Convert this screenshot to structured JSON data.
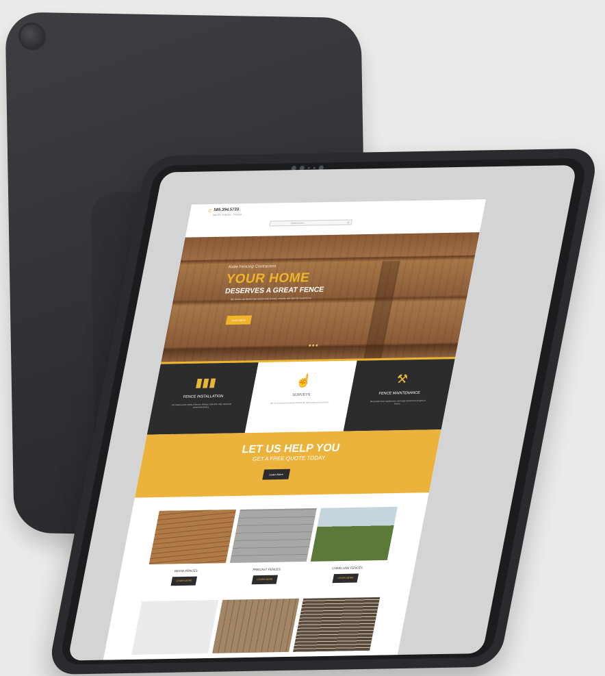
{
  "header": {
    "phone": "585.394.5733",
    "phone_sub": "Mon-Fri: 8:00 am - 7:00 pm",
    "search_placeholder": "Search here..."
  },
  "hero": {
    "kicker": "Katie Fencing Contractors",
    "title": "YOUR HOME",
    "subtitle": "DESERVES A GREAT FENCE",
    "text": "Our fences are built to last and provide privacy, security and style for every home.",
    "button": "Learn More",
    "slides": 3
  },
  "services": [
    {
      "title": "FENCE INSTALLATION",
      "text": "We install a wide variety of fences. Privacy, chain link, vinyl, wood and ornamental fences.",
      "icon": "fence-icon"
    },
    {
      "title": "SURVEYS",
      "text": "We can survey your property and find the right location for your fence.",
      "icon": "survey-hand-icon"
    },
    {
      "title": "FENCE MAINTENANCE",
      "text": "We provide fence maintenance and repair services for all types of fences.",
      "icon": "hammer-icon"
    }
  ],
  "cta": {
    "title": "LET US HELP YOU",
    "subtitle": "GET A FREE QUOTE TODAY",
    "button": "Learn More"
  },
  "products": [
    {
      "name": "WOOD FENCES",
      "button": "LEARN MORE"
    },
    {
      "name": "PRECAST FENCES",
      "button": "LEARN MORE"
    },
    {
      "name": "CHAIN LINK FENCES",
      "button": "LEARN MORE"
    }
  ],
  "colors": {
    "accent": "#f0b429",
    "dark": "#2c2c2e",
    "tablet": "#2a2b2e",
    "background": "#ebebea"
  }
}
